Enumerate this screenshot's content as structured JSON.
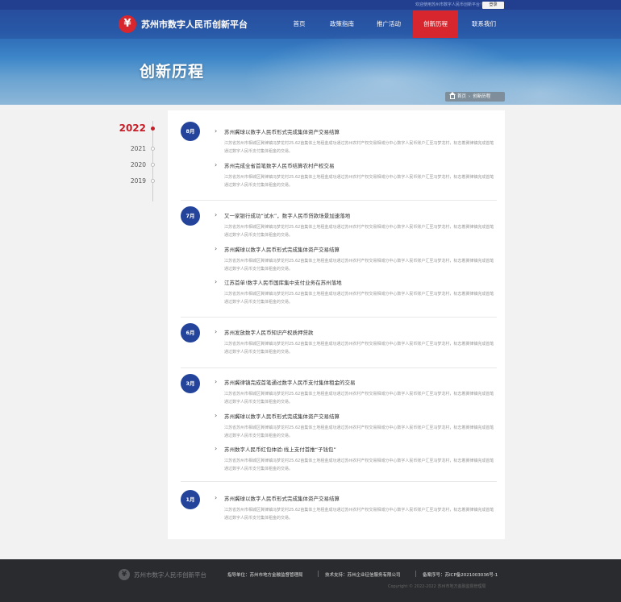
{
  "topbar": {
    "welcome": "欢迎使用苏州市数字人民币创新平台！",
    "login": "登录"
  },
  "logo": {
    "text": "苏州市数字人民币创新平台"
  },
  "nav": [
    {
      "label": "首页"
    },
    {
      "label": "政策指南"
    },
    {
      "label": "推广活动"
    },
    {
      "label": "创新历程"
    },
    {
      "label": "联系我们"
    }
  ],
  "nav_active": "创新历程",
  "banner": {
    "title": "创新历程"
  },
  "breadcrumb": {
    "home": "首页",
    "current": "创新历程"
  },
  "years": [
    {
      "label": "2022",
      "active": true
    },
    {
      "label": "2021",
      "active": false
    },
    {
      "label": "2020",
      "active": false
    },
    {
      "label": "2019",
      "active": false
    }
  ],
  "groups": [
    {
      "month": "8月",
      "items": [
        {
          "title": "苏州冀球以数字人民币形式完成集体资产交易结算",
          "desc": "江苏省苏州市相城区冀律镇冯梦龙村25.62亩集体土地租金成功通过苏州农村产权交易相城分中心数字人民币账户汇至冯梦龙村，标志着冀律镇完成首笔通过数字人民币支付集体租金的交易。"
        },
        {
          "title": "苏州完成全省首笔数字人民币结算农村产权交易",
          "desc": "江苏省苏州市相城区冀律镇冯梦龙村25.62亩集体土地租金成功通过苏州农村产权交易相城分中心数字人民币账户汇至冯梦龙村，标志着冀律镇完成首笔通过数字人民币支付集体租金的交易。"
        }
      ]
    },
    {
      "month": "7月",
      "items": [
        {
          "title": "又一家银行成功“试水”，数字人民币贷款场景加速落地",
          "desc": "江苏省苏州市相城区冀律镇冯梦龙村25.62亩集体土地租金成功通过苏州农村产权交易相城分中心数字人民币账户汇至冯梦龙村，标志着冀律镇完成首笔通过数字人民币支付集体租金的交易。"
        },
        {
          "title": "苏州冀球以数字人民币形式完成集体资产交易结算",
          "desc": "江苏省苏州市相城区冀律镇冯梦龙村25.62亩集体土地租金成功通过苏州农村产权交易相城分中心数字人民币账户汇至冯梦龙村，标志着冀律镇完成首笔通过数字人民币支付集体租金的交易。"
        },
        {
          "title": "江苏首单!数字人民币国库集中支付业务在苏州落地",
          "desc": "江苏省苏州市相城区冀律镇冯梦龙村25.62亩集体土地租金成功通过苏州农村产权交易相城分中心数字人民币账户汇至冯梦龙村，标志着冀律镇完成首笔通过数字人民币支付集体租金的交易。"
        }
      ]
    },
    {
      "month": "6月",
      "items": [
        {
          "title": "苏州发放数字人民币知识产权质押贷款",
          "desc": "江苏省苏州市相城区冀律镇冯梦龙村25.62亩集体土地租金成功通过苏州农村产权交易相城分中心数字人民币账户汇至冯梦龙村，标志着冀律镇完成首笔通过数字人民币支付集体租金的交易。"
        }
      ]
    },
    {
      "month": "3月",
      "items": [
        {
          "title": "苏州冀律镇完成首笔通过数字人民币支付集体租金的交易",
          "desc": "江苏省苏州市相城区冀律镇冯梦龙村25.62亩集体土地租金成功通过苏州农村产权交易相城分中心数字人民币账户汇至冯梦龙村，标志着冀律镇完成首笔通过数字人民币支付集体租金的交易。"
        },
        {
          "title": "苏州冀球以数字人民币形式完成集体资产交易结算",
          "desc": "江苏省苏州市相城区冀律镇冯梦龙村25.62亩集体土地租金成功通过苏州农村产权交易相城分中心数字人民币账户汇至冯梦龙村，标志着冀律镇完成首笔通过数字人民币支付集体租金的交易。"
        },
        {
          "title": "苏州数字人民币红包体验:线上支付首推“子钱包”",
          "desc": "江苏省苏州市相城区冀律镇冯梦龙村25.62亩集体土地租金成功通过苏州农村产权交易相城分中心数字人民币账户汇至冯梦龙村，标志着冀律镇完成首笔通过数字人民币支付集体租金的交易。"
        }
      ]
    },
    {
      "month": "1月",
      "items": [
        {
          "title": "苏州冀球以数字人民币形式完成集体资产交易结算",
          "desc": "江苏省苏州市相城区冀律镇冯梦龙村25.62亩集体土地租金成功通过苏州农村产权交易相城分中心数字人民币账户汇至冯梦龙村，标志着冀律镇完成首笔通过数字人民币支付集体租金的交易。"
        }
      ]
    }
  ],
  "footer": {
    "logo_text": "苏州市数字人民币创新平台",
    "guide": "指导单位：苏州市地方金融监督管理局",
    "tech": "技术支持：苏州企业征信服务有限公司",
    "icp": "备案序号：苏ICP备2021003036号-1",
    "copyright": "Copyright © 2022-2022 苏州市地方金融监督管理局"
  },
  "colors": {
    "brand_red": "#d7262d",
    "brand_blue": "#23449a",
    "footer_bg": "#292b2e"
  }
}
